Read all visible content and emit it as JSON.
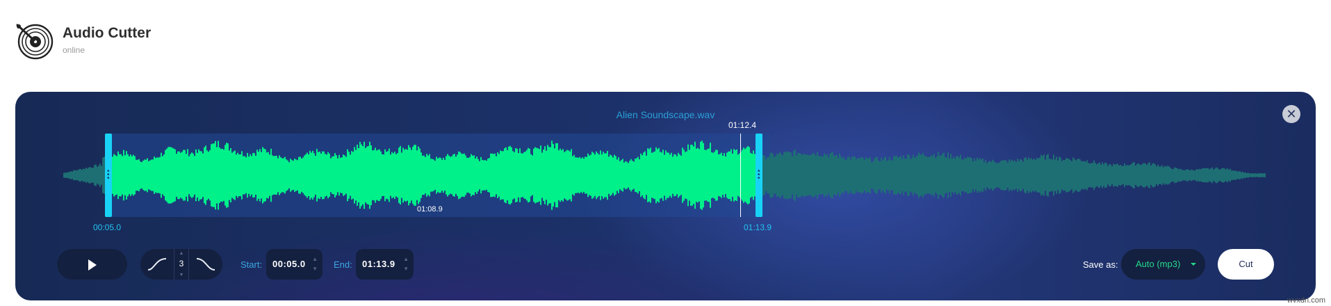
{
  "header": {
    "title": "Audio Cutter",
    "subtitle": "online",
    "logo_icon": "vinyl-record-icon"
  },
  "editor": {
    "filename": "Alien Soundscape.wav",
    "close_icon": "close-icon",
    "selection": {
      "start_label": "00:05.0",
      "end_label": "01:13.9",
      "playhead_label": "01:12.4",
      "hover_label": "01:08.9"
    },
    "colors": {
      "waveform_selected": "#00f08a",
      "waveform_unselected": "#1e6f74",
      "handle": "#19d3f6",
      "accent_text": "#25c3f0"
    }
  },
  "controls": {
    "play_icon": "play-icon",
    "fade_in_icon": "fade-in-icon",
    "fade_out_icon": "fade-out-icon",
    "fade_value": "3",
    "start_label": "Start:",
    "start_value": "00:05.0",
    "end_label": "End:",
    "end_value": "01:13.9",
    "save_as_label": "Save as:",
    "format_value": "Auto (mp3)",
    "cut_label": "Cut"
  },
  "watermark": "wvxdn.com"
}
